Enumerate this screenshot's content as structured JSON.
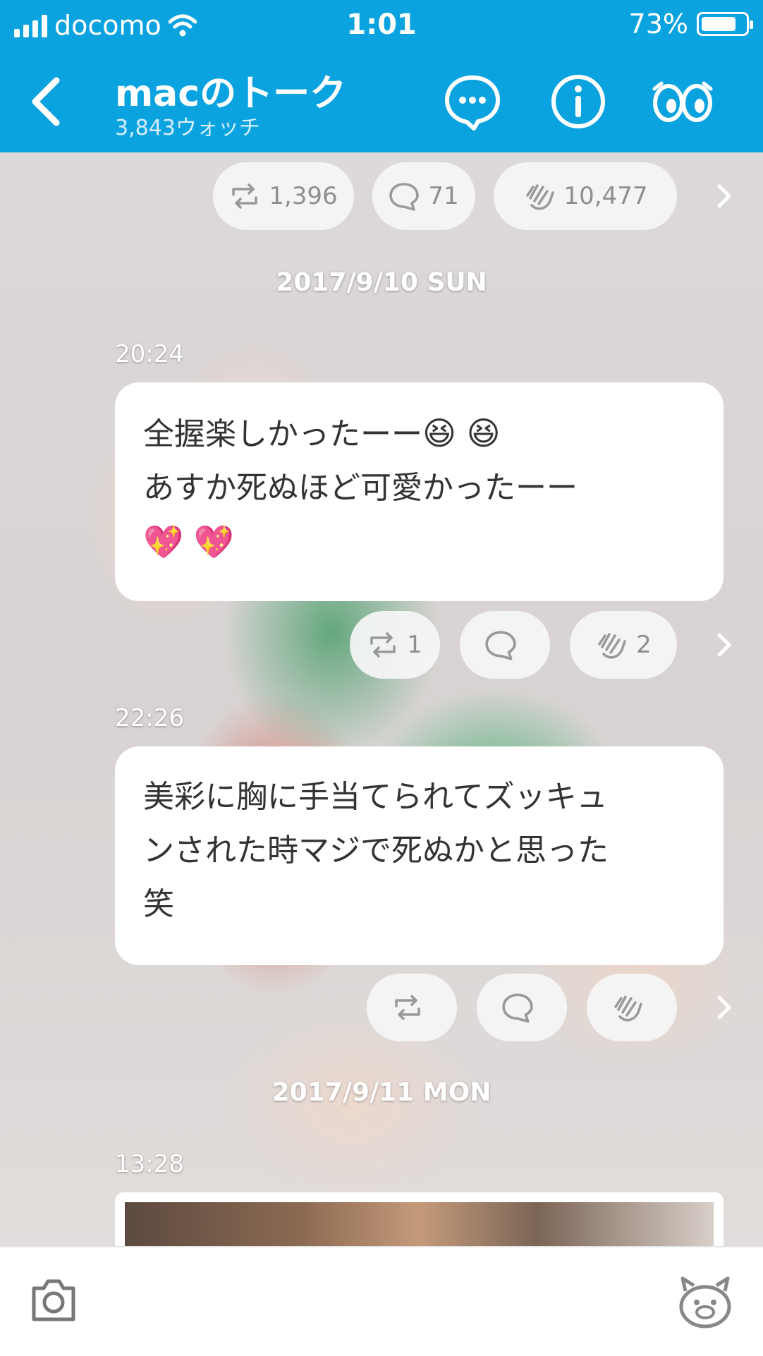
{
  "status": {
    "carrier": "docomo",
    "time": "1:01",
    "battery": "73%"
  },
  "header": {
    "back_icon": "chevron-left-icon",
    "title": "macのトーク",
    "subtitle": "3,843ウォッチ",
    "actions": [
      "chat-bubble-icon",
      "info-icon",
      "watch-eyes-icon"
    ]
  },
  "top_reactions": {
    "repost": "1,396",
    "comment": "71",
    "clap": "10,477"
  },
  "feed": {
    "date1": "2017/9/10 SUN",
    "msg1": {
      "time": "20:24",
      "line1": "全握楽しかったーー",
      "line1_emoji": "😆 😆",
      "line2": "あすか死ぬほど可愛かったーー",
      "line3_emoji": "💖 💖",
      "repost": "1",
      "comment": "",
      "clap": "2"
    },
    "msg2": {
      "time": "22:26",
      "line1": "美彩に胸に手当てられてズッキュ",
      "line2": "ンされた時マジで死ぬかと思った",
      "line3": "笑",
      "repost": "",
      "comment": "",
      "clap": ""
    },
    "date2": "2017/9/11 MON",
    "msg3": {
      "time": "13:28"
    }
  },
  "bottom": {
    "left_icon": "camera-icon",
    "right_icon": "bear-mascot-icon"
  },
  "colors": {
    "brand": "#0aa3e0",
    "pill": "#f6f6f6",
    "text": "#333333"
  }
}
